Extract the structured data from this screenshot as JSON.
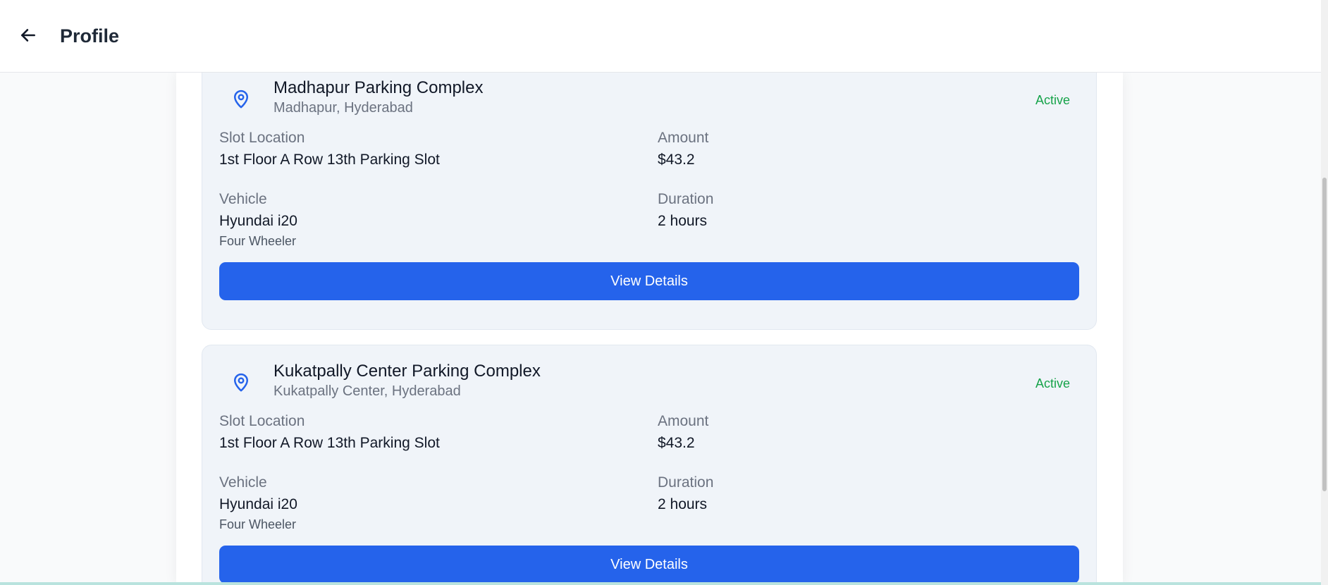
{
  "header": {
    "title": "Profile",
    "back_icon": "arrow-left-icon"
  },
  "bookings": [
    {
      "name": "Madhapur Parking Complex",
      "area": "Madhapur, Hyderabad",
      "status": "Active",
      "slot_label": "Slot Location",
      "slot_value": "1st Floor A Row 13th Parking Slot",
      "amount_label": "Amount",
      "amount_value": "$43.2",
      "vehicle_label": "Vehicle",
      "vehicle_value": "Hyundai i20",
      "vehicle_type": "Four Wheeler",
      "duration_label": "Duration",
      "duration_value": "2 hours",
      "button_label": "View Details"
    },
    {
      "name": "Kukatpally Center Parking Complex",
      "area": "Kukatpally Center, Hyderabad",
      "status": "Active",
      "slot_label": "Slot Location",
      "slot_value": "1st Floor A Row 13th Parking Slot",
      "amount_label": "Amount",
      "amount_value": "$43.2",
      "vehicle_label": "Vehicle",
      "vehicle_value": "Hyundai i20",
      "vehicle_type": "Four Wheeler",
      "duration_label": "Duration",
      "duration_value": "2 hours",
      "button_label": "View Details"
    }
  ],
  "colors": {
    "primary": "#2563eb",
    "status_active": "#16a34a",
    "pin": "#2563eb"
  },
  "icons": {
    "location": "map-pin-icon"
  }
}
